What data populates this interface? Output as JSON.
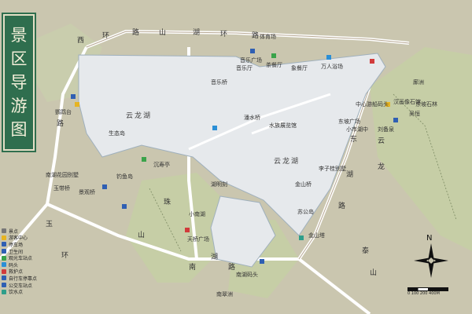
{
  "title": "景区导游图",
  "lake_labels": [
    "云龙湖",
    "云龙湖"
  ],
  "road_labels": [
    "西",
    "环",
    "路",
    "山",
    "湖",
    "环",
    "路",
    "路",
    "珠",
    "山",
    "玉",
    "环",
    "南",
    "湖",
    "路",
    "泰",
    "山",
    "东",
    "湖",
    "路",
    "龙",
    "云"
  ],
  "place_labels": [
    "体育场",
    "音乐广场",
    "音乐厅",
    "茶餐厅",
    "象餐厅",
    "万人浴场",
    "音乐桥",
    "中心游船码头",
    "刘备泉",
    "东坡广场",
    "廓洲",
    "水族展览馆",
    "潘水桥",
    "生态岛",
    "鹦鹉台",
    "钓鱼岛",
    "沉寿亭",
    "小南湖",
    "湖明刻",
    "吴恒",
    "汉画像石馆",
    "东坡石林",
    "小市湖中",
    "南湖花园别墅",
    "玉带桥",
    "景观桥",
    "李子桂别墅",
    "金山桥",
    "苏公岛",
    "金山塔",
    "天桥广场",
    "南湖码头",
    "南翠洲"
  ],
  "legend": [
    {
      "label": "景点",
      "color": "#777777"
    },
    {
      "label": "游客中心",
      "color": "#e6b422"
    },
    {
      "label": "停车场",
      "color": "#2f5fb3"
    },
    {
      "label": "卫生间",
      "color": "#2f5fb3"
    },
    {
      "label": "观光车站点",
      "color": "#3aa34a"
    },
    {
      "label": "码头",
      "color": "#2b8fd6"
    },
    {
      "label": "救护点",
      "color": "#d13b3b"
    },
    {
      "label": "自行车停靠点",
      "color": "#2f5fb3"
    },
    {
      "label": "公交车站点",
      "color": "#2f5fb3"
    },
    {
      "label": "饮水点",
      "color": "#2f9e8a"
    }
  ],
  "north_label": "N",
  "scale_label": "0  100  200     400M",
  "colors": {
    "lake": "#e6e9ec",
    "hill": "#c8cfa8",
    "land": "#cac6af",
    "road": "#ffffff",
    "title_bg": "#2f6e4e"
  }
}
